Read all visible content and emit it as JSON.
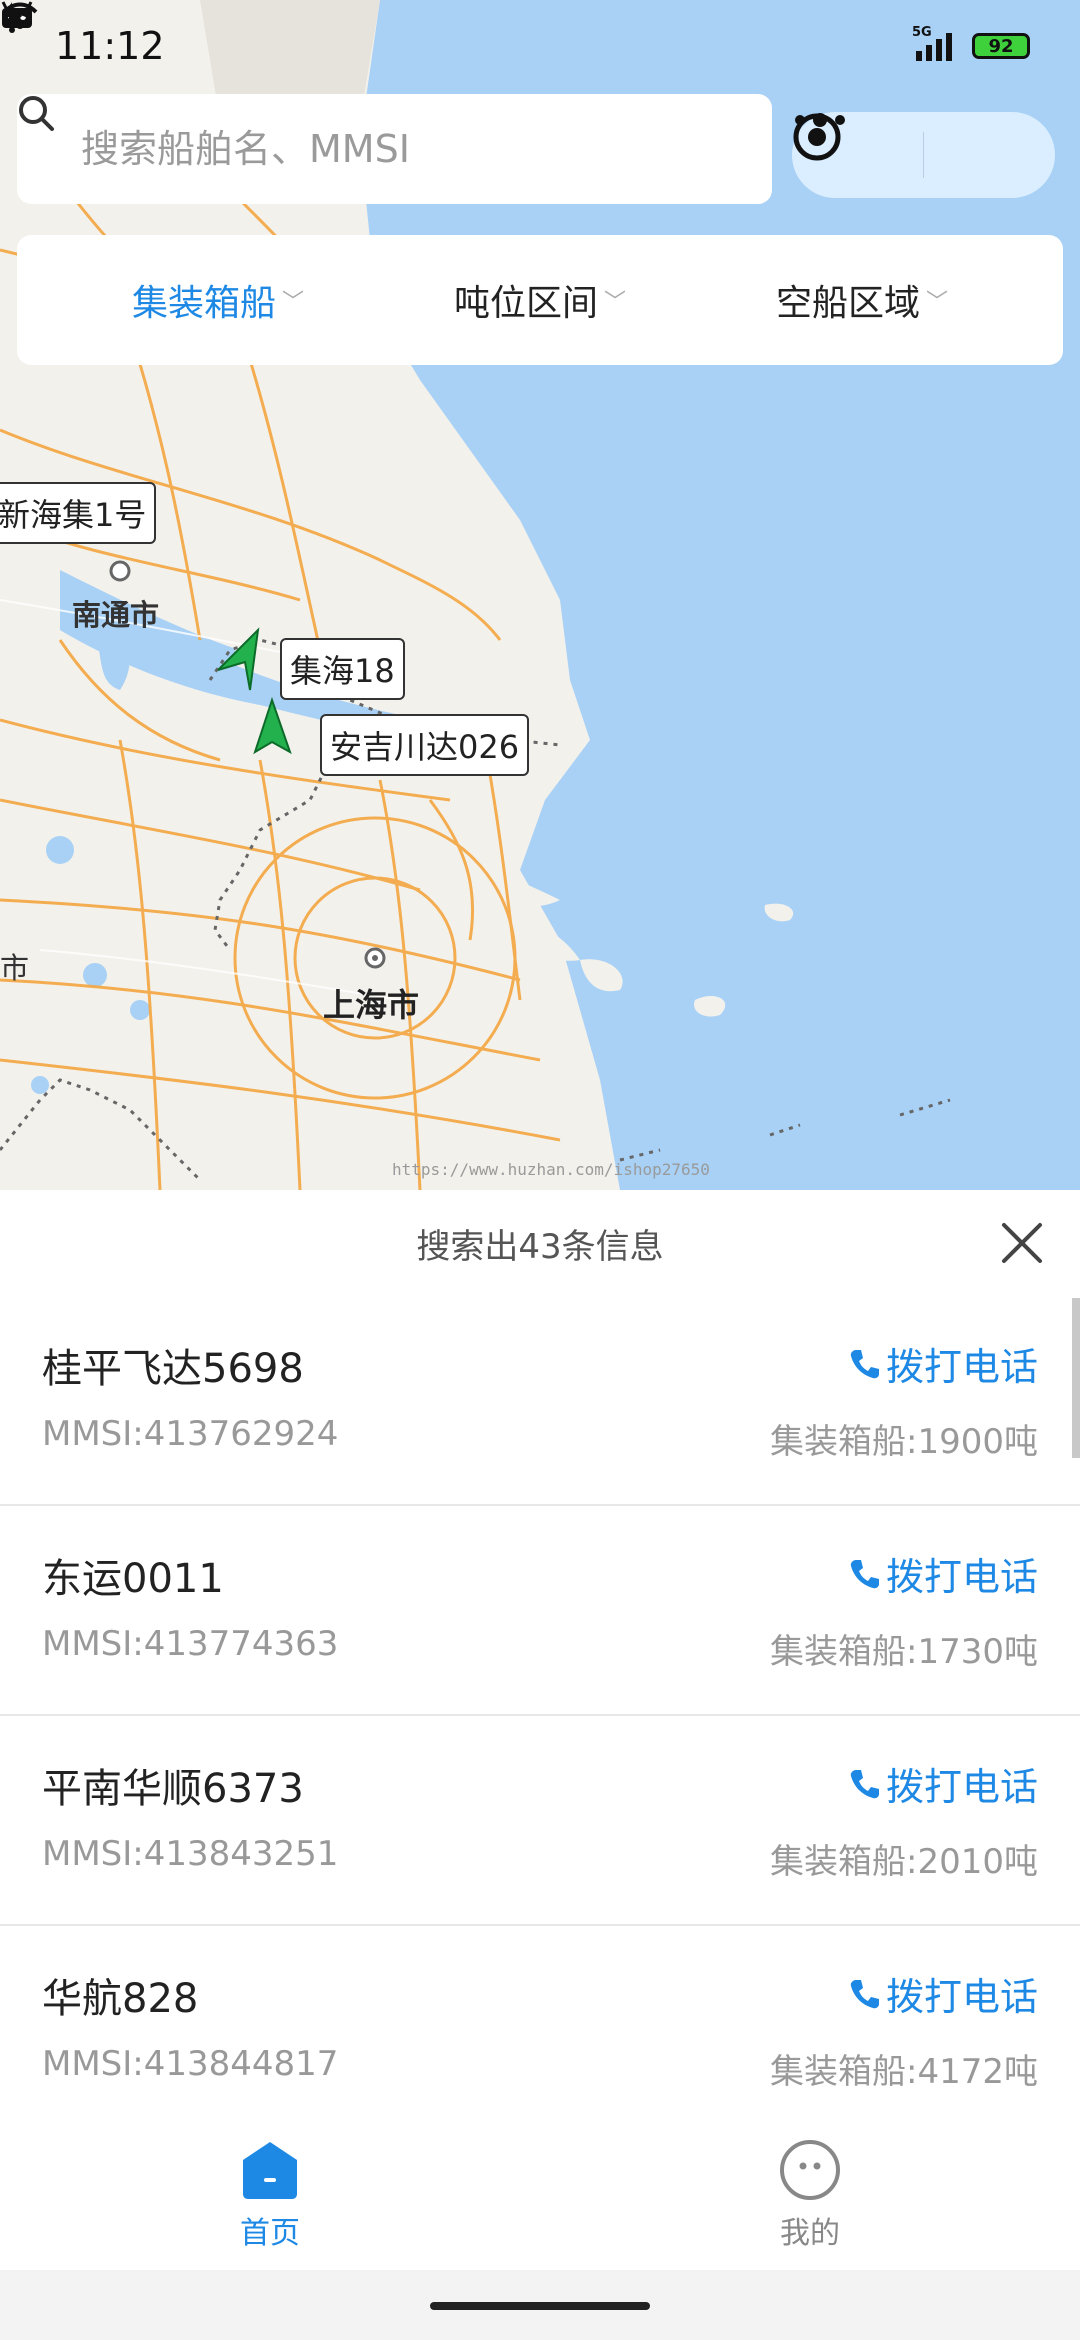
{
  "status_bar": {
    "time": "11:12",
    "network": "5G",
    "battery": "92"
  },
  "search": {
    "placeholder": "搜索船舶名、MMSI"
  },
  "filters": [
    {
      "label": "集装箱船",
      "active": true
    },
    {
      "label": "吨位区间",
      "active": false
    },
    {
      "label": "空船区域",
      "active": false
    }
  ],
  "map": {
    "cities": [
      "南通市",
      "上海市",
      "市"
    ],
    "ship_labels": [
      "新海集1号",
      "集海18",
      "安吉川达026"
    ],
    "watermark": "https://www.huzhan.com/ishop27650"
  },
  "results": {
    "summary": "搜索出43条信息",
    "call_label": "拨打电话",
    "ships": [
      {
        "name": "桂平飞达5698",
        "mmsi": "MMSI:413762924",
        "type": "集装箱船:1900吨"
      },
      {
        "name": "东运0011",
        "mmsi": "MMSI:413774363",
        "type": "集装箱船:1730吨"
      },
      {
        "name": "平南华顺6373",
        "mmsi": "MMSI:413843251",
        "type": "集装箱船:2010吨"
      },
      {
        "name": "华航828",
        "mmsi": "MMSI:413844817",
        "type": "集装箱船:4172吨"
      }
    ]
  },
  "tabbar": {
    "home": "首页",
    "mine": "我的"
  },
  "colors": {
    "accent": "#1e88e5",
    "water": "#a8d1f5",
    "land": "#f3f1ec",
    "road": "#f4a640"
  }
}
